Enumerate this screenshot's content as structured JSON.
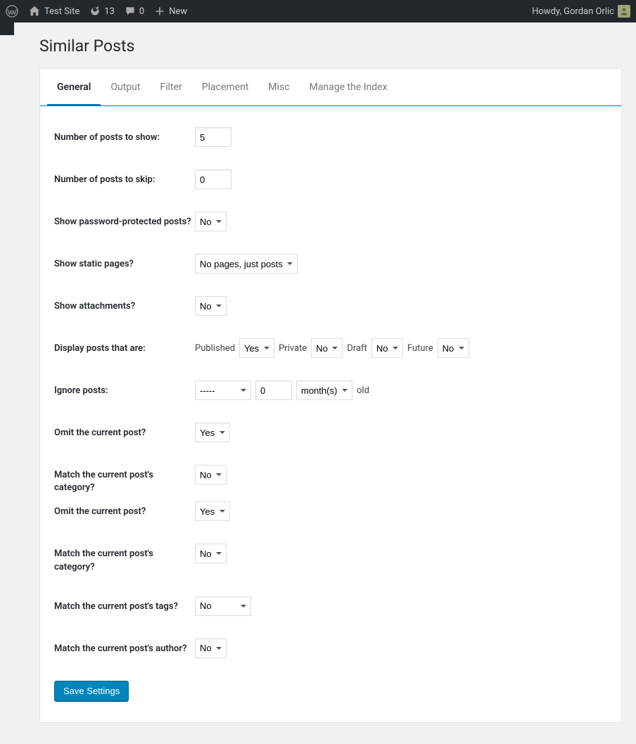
{
  "adminbar": {
    "site_name": "Test Site",
    "updates_count": "13",
    "comments_count": "0",
    "new_label": "New",
    "howdy": "Howdy, Gordan Orlic"
  },
  "page_title": "Similar Posts",
  "tabs": [
    {
      "label": "General",
      "active": true
    },
    {
      "label": "Output",
      "active": false
    },
    {
      "label": "Filter",
      "active": false
    },
    {
      "label": "Placement",
      "active": false
    },
    {
      "label": "Misc",
      "active": false
    },
    {
      "label": "Manage the Index",
      "active": false
    }
  ],
  "form": {
    "num_show": {
      "label": "Number of posts to show:",
      "value": "5"
    },
    "num_skip": {
      "label": "Number of posts to skip:",
      "value": "0"
    },
    "show_pw": {
      "label": "Show password-protected posts?",
      "value": "No"
    },
    "show_static": {
      "label": "Show static pages?",
      "value": "No pages, just posts"
    },
    "show_attach": {
      "label": "Show attachments?",
      "value": "No"
    },
    "display_posts": {
      "label": "Display posts that are:",
      "published_label": "Published",
      "published_value": "Yes",
      "private_label": "Private",
      "private_value": "No",
      "draft_label": "Draft",
      "draft_value": "No",
      "future_label": "Future",
      "future_value": "No"
    },
    "ignore": {
      "label": "Ignore posts:",
      "compare_value": "-----",
      "num_value": "0",
      "unit_value": "month(s)",
      "old_label": "old"
    },
    "omit_current1": {
      "label": "Omit the current post?",
      "value": "Yes"
    },
    "match_cat1": {
      "label": "Match the current post's category?",
      "value": "No"
    },
    "omit_current2": {
      "label": "Omit the current post?",
      "value": "Yes"
    },
    "match_cat2": {
      "label": "Match the current post's category?",
      "value": "No"
    },
    "match_tags": {
      "label": "Match the current post's tags?",
      "value": "No"
    },
    "match_author": {
      "label": "Match the current post's author?",
      "value": "No"
    }
  },
  "save_button": "Save Settings"
}
